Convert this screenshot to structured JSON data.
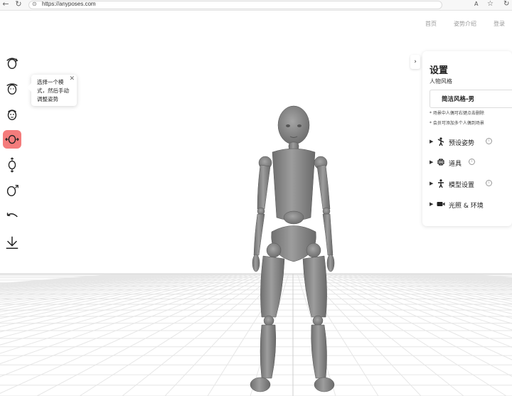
{
  "browser": {
    "url": "https://anyposes.com",
    "back_icon": "back-arrow-icon",
    "reload_icon": "reload-icon",
    "lock_icon": "lock-icon",
    "reader_label": "A",
    "star_icon": "star-icon"
  },
  "nav": {
    "items": [
      {
        "label": "首页"
      },
      {
        "label": "姿势介绍"
      },
      {
        "label": "登录"
      }
    ]
  },
  "toolbar": {
    "tools": [
      {
        "icon": "head-rotate-icon",
        "active": false
      },
      {
        "icon": "head-tilt-icon",
        "active": false
      },
      {
        "icon": "face-icon",
        "active": false
      },
      {
        "icon": "head-move-horizontal-icon",
        "active": true
      },
      {
        "icon": "head-move-vertical-icon",
        "active": false
      },
      {
        "icon": "head-rotate-diagonal-icon",
        "active": false
      },
      {
        "icon": "undo-icon",
        "active": false
      },
      {
        "icon": "download-icon",
        "active": false
      }
    ],
    "active_color": "#f47c7c"
  },
  "tooltip": {
    "text": "选择一个模式，然后手动调整姿势",
    "close": "✕"
  },
  "panel": {
    "toggle": "›",
    "title": "设置",
    "style_label": "人物风格",
    "style_value": "简洁风格-男",
    "notes": [
      "* 场景中人偶可右键点击删除",
      "* 会员可添加多个人偶到场景"
    ],
    "sections": [
      {
        "label": "预设姿势",
        "icon": "pose-figure-icon",
        "info": true
      },
      {
        "label": "道具",
        "icon": "basketball-icon",
        "info": true
      },
      {
        "label": "模型设置",
        "icon": "person-icon",
        "info": true
      },
      {
        "label": "光照 & 环境",
        "icon": "video-camera-icon",
        "info": false
      }
    ],
    "info_symbol": "i",
    "caret": "▶"
  }
}
